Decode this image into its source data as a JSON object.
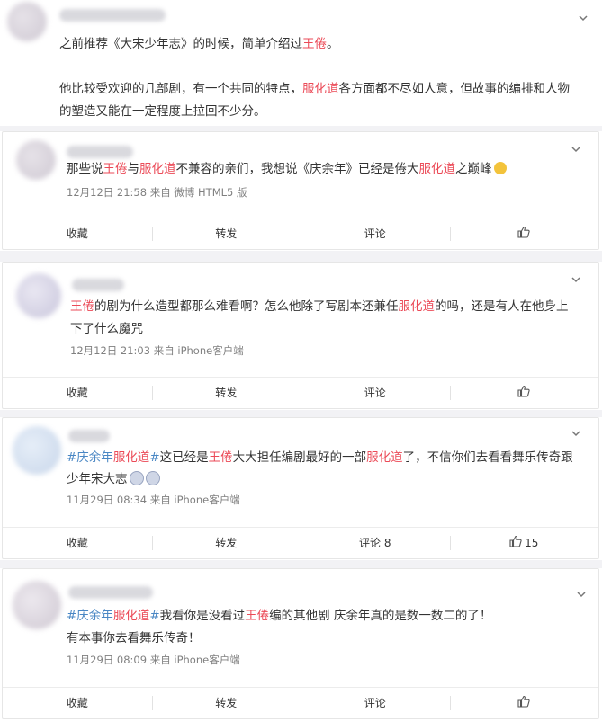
{
  "post": {
    "para1_a": "之前推荐《大宋少年志》的时候，简单介绍过",
    "para1_hl": "王倦",
    "para1_b": "。",
    "para2_a": "他比较受欢迎的几部剧，有一个共同的特点，",
    "para2_hl": "服化道",
    "para2_b": "各方面都不尽如人意，但故事的编排和人物",
    "para3": "的塑造又能在一定程度上拉回不少分。"
  },
  "comments": [
    {
      "t1": "那些说",
      "h1": "王倦",
      "t2": "与",
      "h2": "服化道",
      "t3": "不兼容的亲们，我想说《庆余年》已经是倦大",
      "h3": "服化道",
      "t4": "之巅峰",
      "meta": "12月12日 21:58 来自 微博 HTML5 版",
      "collect": "收藏",
      "forward": "转发",
      "comment": "评论"
    },
    {
      "h1": "王倦",
      "t1": "的剧为什么造型都那么难看啊？怎么他除了写剧本还兼任",
      "h2": "服化道",
      "t2": "的吗，还是有人在他身上",
      "line2": "下了什么魔咒",
      "meta": "12月12日 21:03 来自 iPhone客户端",
      "collect": "收藏",
      "forward": "转发",
      "comment": "评论"
    },
    {
      "tag1": "#庆余年",
      "hl_tag": "服化道",
      "tag2": "#",
      "t1": "这已经是",
      "h1": "王倦",
      "t2": "大大担任编剧最好的一部",
      "h2": "服化道",
      "t3": "了，不信你们去看看舞乐传奇跟",
      "line2": "少年宋大志",
      "meta": "11月29日 08:34 来自 iPhone客户端",
      "collect": "收藏",
      "forward": "转发",
      "comment": "评论 8",
      "like": "15"
    },
    {
      "tag1": "#庆余年",
      "hl_tag": "服化道",
      "tag2": "#",
      "t1": "我看你是没看过",
      "h1": "王倦",
      "t2": "编的其他剧 庆余年真的是数一数二的了！",
      "line2": "有本事你去看舞乐传奇！",
      "meta": "11月29日 08:09 来自 iPhone客户端",
      "collect": "收藏",
      "forward": "转发",
      "comment": "评论"
    }
  ]
}
